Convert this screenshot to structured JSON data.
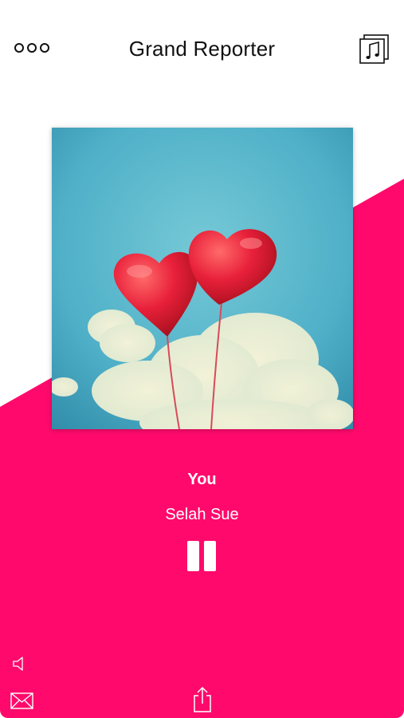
{
  "header": {
    "title": "Grand Reporter",
    "menu_icon": "more-icon",
    "library_icon": "music-library-icon"
  },
  "artwork": {
    "description_icon": "album-artwork"
  },
  "track": {
    "title": "You",
    "artist": "Selah Sue"
  },
  "controls": {
    "playback_icon": "pause-icon",
    "volume_icon": "speaker-icon",
    "mail_icon": "mail-icon",
    "share_icon": "share-icon"
  },
  "colors": {
    "accent": "#ff0a6c",
    "background": "#ffffff",
    "text_light": "#ffffff",
    "text_dark": "#111111"
  }
}
